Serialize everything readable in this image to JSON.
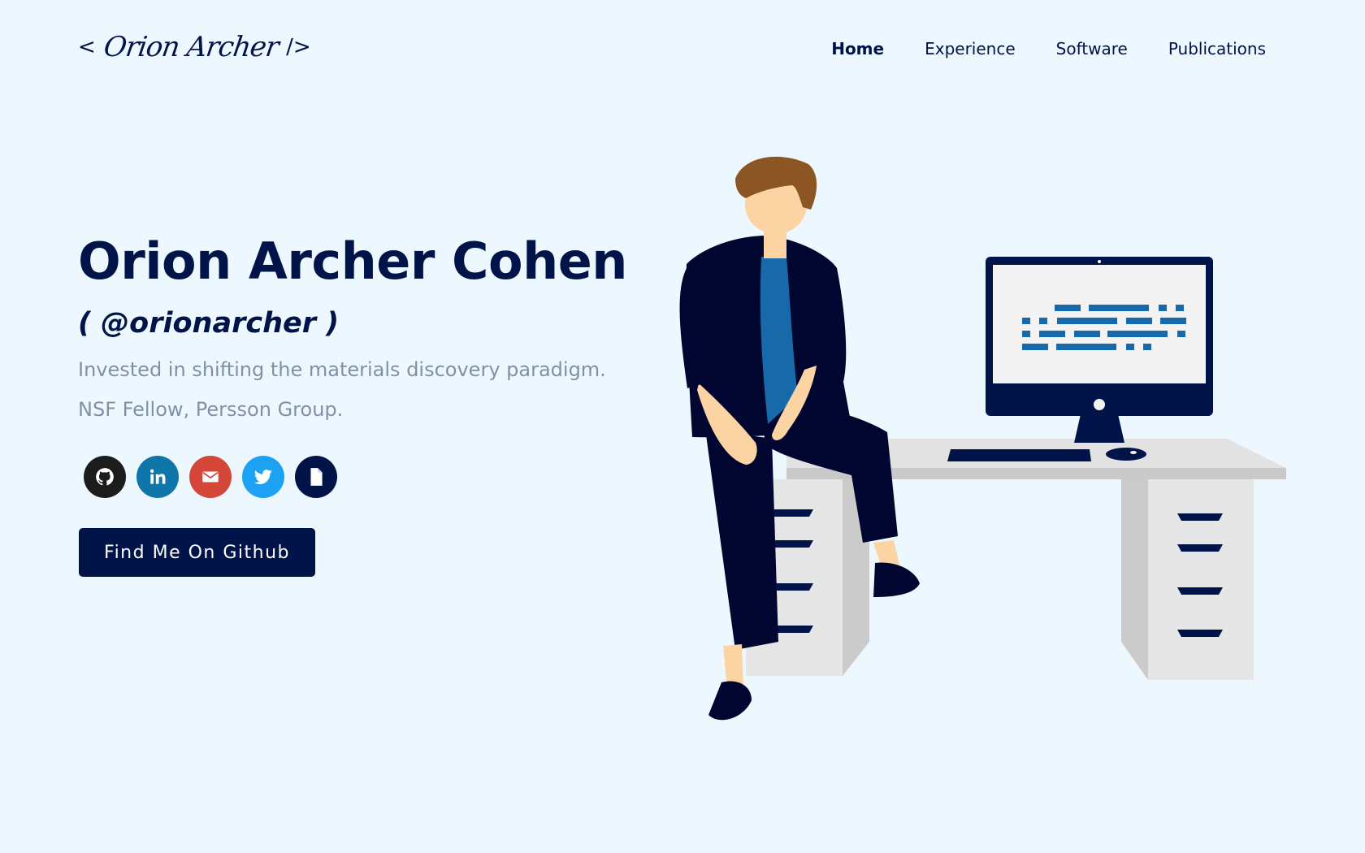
{
  "header": {
    "logo": {
      "open": "<",
      "signature": "Orion Archer",
      "close": "/>"
    },
    "nav": [
      {
        "label": "Home",
        "active": true
      },
      {
        "label": "Experience",
        "active": false
      },
      {
        "label": "Software",
        "active": false
      },
      {
        "label": "Publications",
        "active": false
      }
    ]
  },
  "hero": {
    "name": "Orion Archer Cohen",
    "handle": "( @orionarcher )",
    "tagline": "Invested in shifting the materials discovery paradigm.",
    "affiliation": "NSF Fellow, Persson Group.",
    "socials": [
      {
        "icon": "github-icon",
        "color": "#1c1c1c"
      },
      {
        "icon": "linkedin-icon",
        "color": "#0e76a8"
      },
      {
        "icon": "email-icon",
        "color": "#d44638"
      },
      {
        "icon": "twitter-icon",
        "color": "#1da1f2"
      },
      {
        "icon": "document-icon",
        "color": "#001449"
      }
    ],
    "cta_label": "Find Me On Github"
  },
  "colors": {
    "primary": "#001449",
    "background": "#edf8fe",
    "muted_text": "#8190a6",
    "accent_blue": "#1769aa"
  }
}
